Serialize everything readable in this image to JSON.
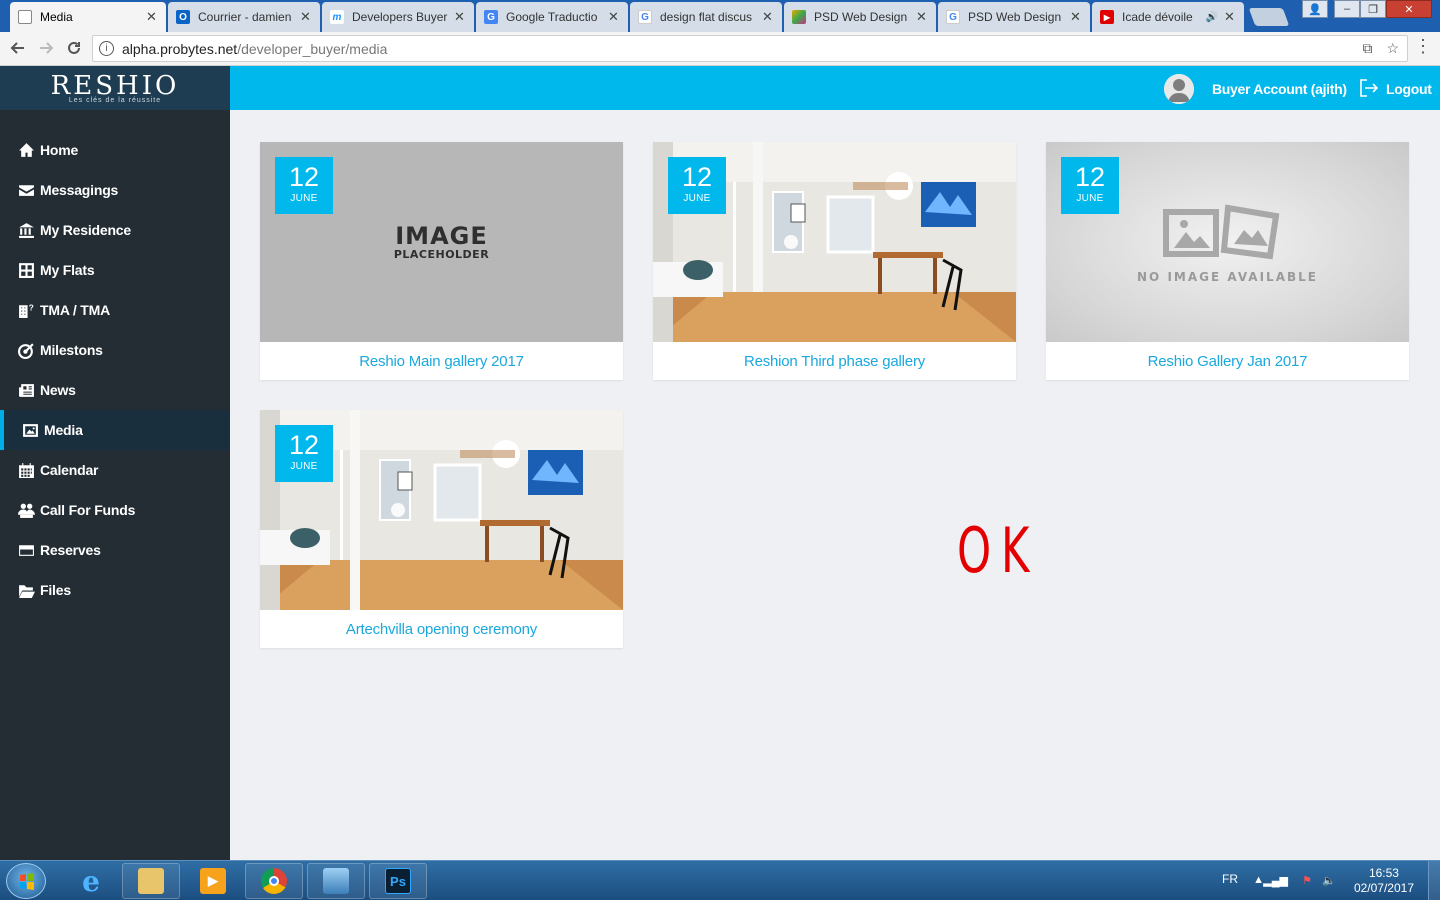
{
  "browser": {
    "tabs": [
      {
        "label": "Media",
        "favicon": "page-icon",
        "color": "#ffffff"
      },
      {
        "label": "Courrier - damien",
        "favicon": "outlook-icon",
        "color": "#0a64c8"
      },
      {
        "label": "Developers Buyer",
        "favicon": "m-logo-icon",
        "color": "#1e90ff"
      },
      {
        "label": "Google Traductio",
        "favicon": "google-translate-icon",
        "color": "#4285f4"
      },
      {
        "label": "design flat discus",
        "favicon": "google-icon",
        "color": "#4285f4"
      },
      {
        "label": "PSD Web Design",
        "favicon": "psd-icon",
        "color": "#e9a800"
      },
      {
        "label": "PSD Web Design",
        "favicon": "google-icon",
        "color": "#4285f4"
      },
      {
        "label": "Icade dévoile",
        "favicon": "youtube-icon",
        "color": "#e00000"
      }
    ],
    "url_host": "alpha.probytes.net",
    "url_path": "/developer_buyer/media"
  },
  "app": {
    "logo": "RESHIO",
    "tagline": "Les clés de la réussite",
    "sidebar": [
      {
        "label": "Home",
        "icon": "home-icon"
      },
      {
        "label": "Messagings",
        "icon": "envelope-icon"
      },
      {
        "label": "My Residence",
        "icon": "bank-icon"
      },
      {
        "label": "My Flats",
        "icon": "grid-icon"
      },
      {
        "label": "TMA / TMA",
        "icon": "building-question-icon"
      },
      {
        "label": "Milestons",
        "icon": "target-icon"
      },
      {
        "label": "News",
        "icon": "newspaper-icon"
      },
      {
        "label": "Media",
        "icon": "picture-icon",
        "active": true
      },
      {
        "label": "Calendar",
        "icon": "calendar-icon"
      },
      {
        "label": "Call For Funds",
        "icon": "people-icon"
      },
      {
        "label": "Reserves",
        "icon": "card-icon"
      },
      {
        "label": "Files",
        "icon": "folder-open-icon"
      }
    ],
    "header": {
      "user": "Buyer Account (ajith)",
      "logout": "Logout"
    },
    "galleries": [
      {
        "title": "Reshio Main gallery 2017",
        "day": "12",
        "month": "JUNE",
        "thumb": "image-placeholder"
      },
      {
        "title": "Reshion Third phase gallery",
        "day": "12",
        "month": "JUNE",
        "thumb": "room-photo"
      },
      {
        "title": "Reshio Gallery Jan 2017",
        "day": "12",
        "month": "JUNE",
        "thumb": "no-image"
      },
      {
        "title": "Artechvilla opening ceremony",
        "day": "12",
        "month": "JUNE",
        "thumb": "room-photo"
      }
    ],
    "placeholder_big": "IMAGE",
    "placeholder_small": "PLACEHOLDER",
    "no_image_text": "NO IMAGE AVAILABLE",
    "annotation": "OK",
    "accent": "#00b8ec",
    "sidebar_bg": "#232d33",
    "annotation_color": "#e40000"
  },
  "taskbar": {
    "apps": [
      "internet-explorer-icon",
      "file-explorer-icon",
      "media-player-icon",
      "chrome-icon",
      "photo-viewer-icon",
      "photoshop-icon"
    ],
    "photoshop_label": "Ps",
    "lang": "FR",
    "time": "16:53",
    "date": "02/07/2017"
  }
}
